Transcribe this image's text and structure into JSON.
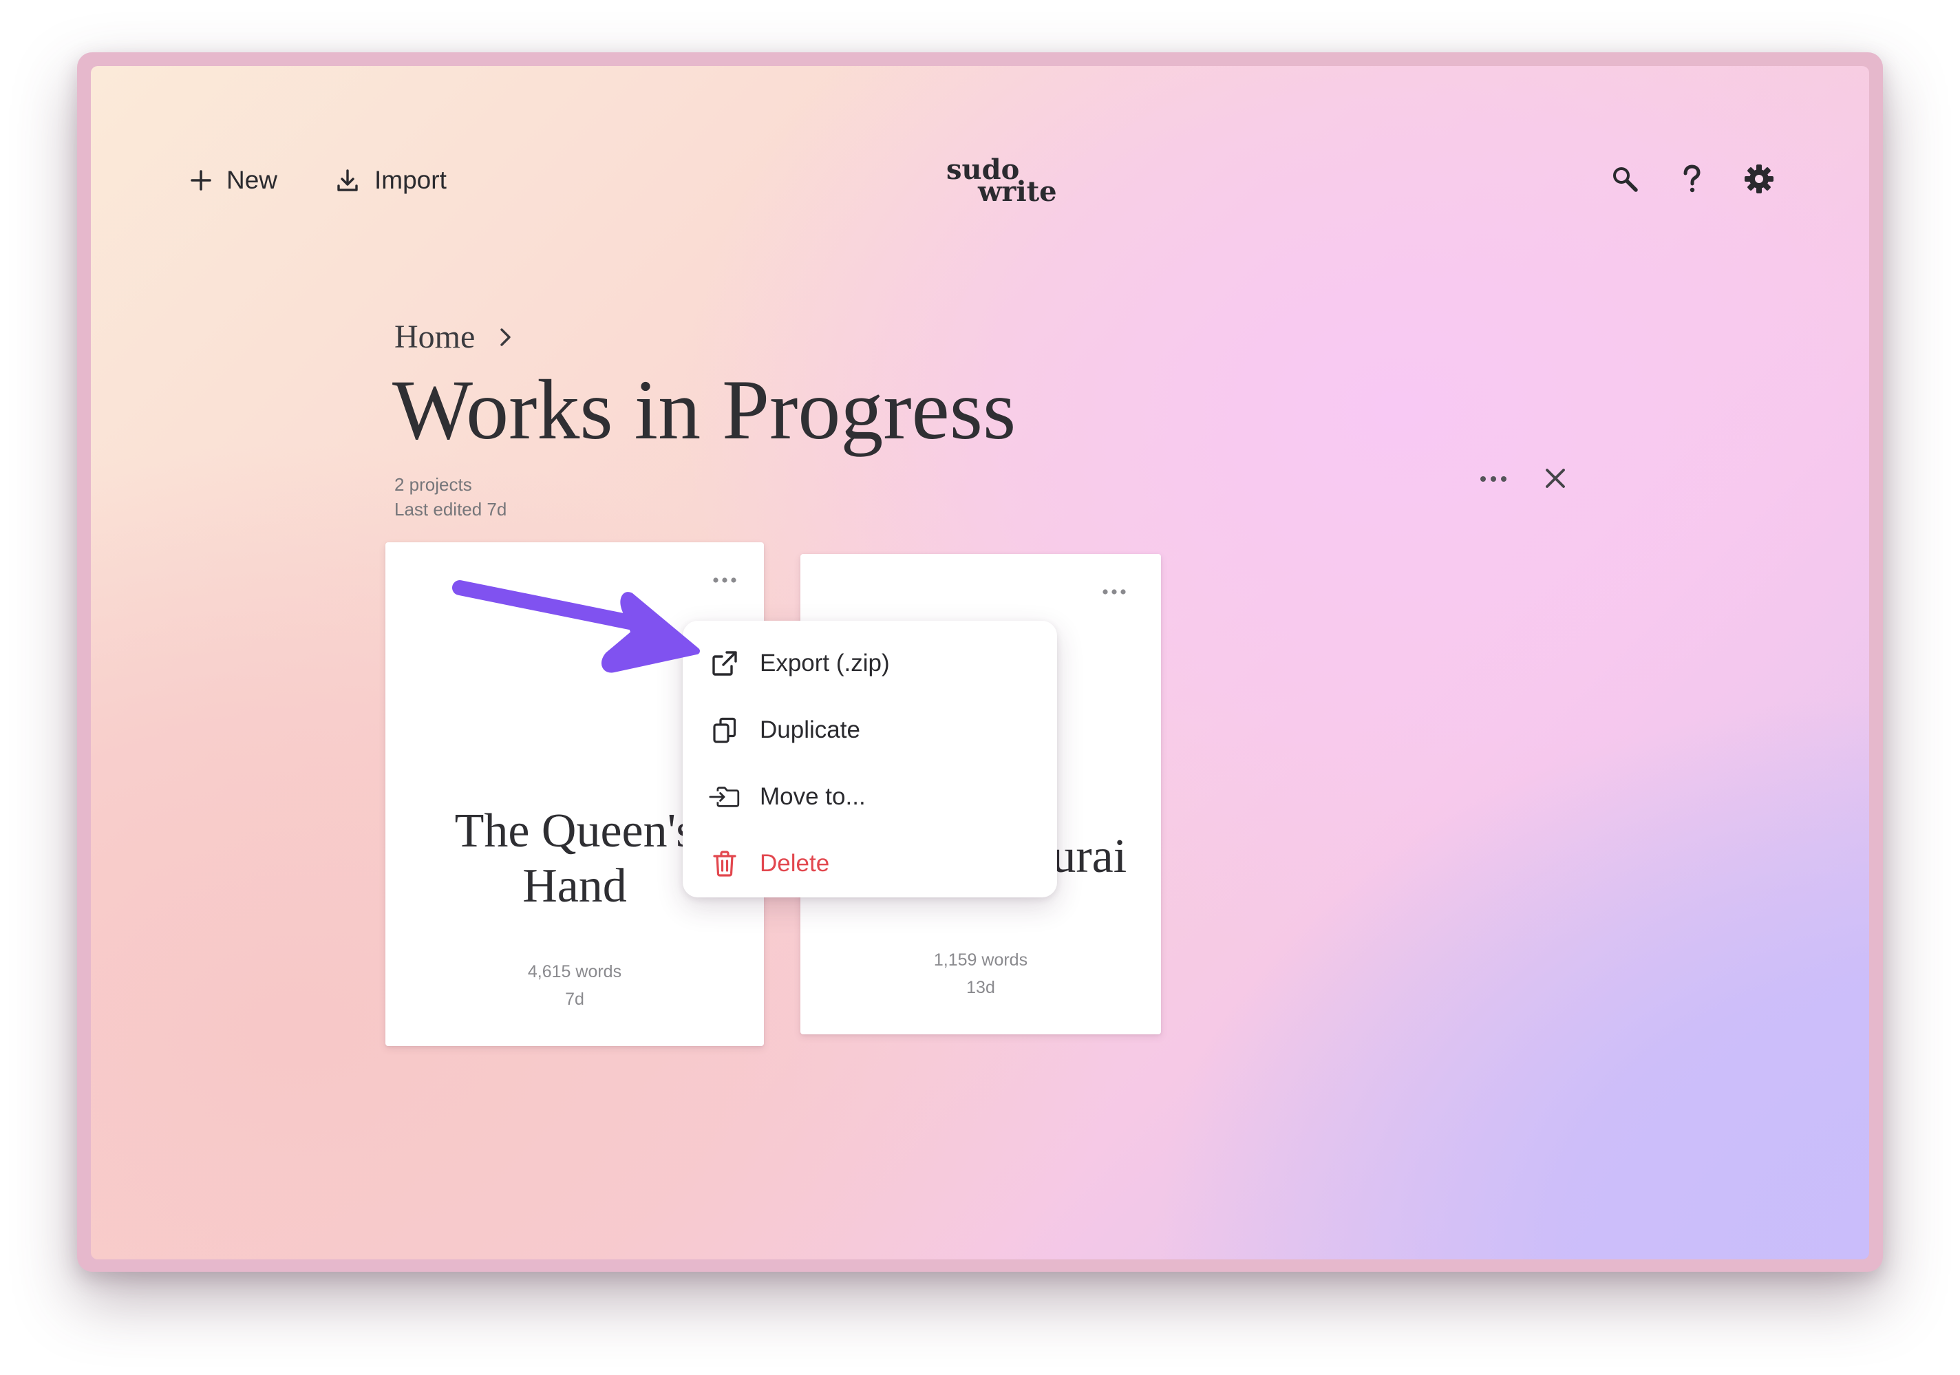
{
  "app": {
    "logo_line1": "sudo",
    "logo_line2": "write"
  },
  "toolbar": {
    "new_label": "New",
    "import_label": "Import",
    "icons": [
      "plus-icon",
      "download-icon",
      "search-icon",
      "help-icon",
      "gear-icon"
    ]
  },
  "breadcrumb": {
    "home_label": "Home",
    "separator_icon": "chevron-right-icon"
  },
  "folder": {
    "title": "Works in Progress",
    "project_count": "2 projects",
    "last_edited": "Last edited 7d",
    "actions": [
      "more-icon",
      "close-icon"
    ]
  },
  "projects": [
    {
      "title": "The Queen's\nHand",
      "words": "4,615 words",
      "edited": "7d"
    },
    {
      "title": "amurai",
      "words": "1,159 words",
      "edited": "13d"
    }
  ],
  "context_menu": {
    "items": [
      {
        "label": "Export (.zip)",
        "icon": "external-link-icon"
      },
      {
        "label": "Duplicate",
        "icon": "copy-icon"
      },
      {
        "label": "Move to...",
        "icon": "folder-move-icon"
      },
      {
        "label": "Delete",
        "icon": "trash-icon",
        "color": "#e2474e"
      }
    ]
  },
  "annotation": {
    "arrow_color": "#8052f0"
  },
  "colors": {
    "frame": "#e6b8cc",
    "text_dark": "#2a2a2e",
    "text_muted": "#76767a",
    "danger": "#e2474e"
  }
}
